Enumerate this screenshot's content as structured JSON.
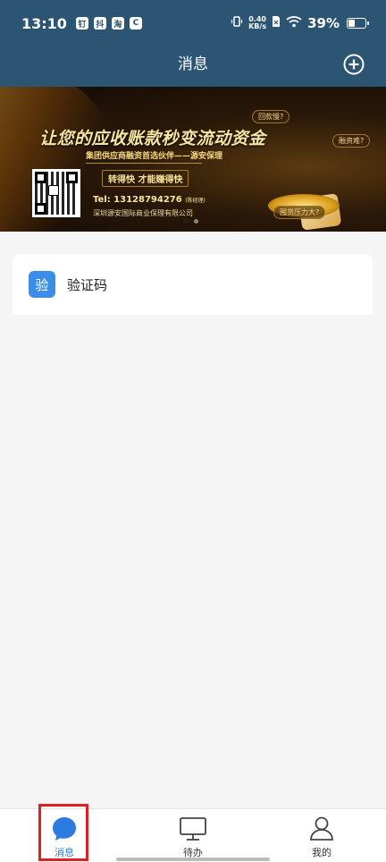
{
  "status_bar": {
    "time": "13:10",
    "app_icons": [
      "钉",
      "抖",
      "淘",
      "C"
    ],
    "net_speed_value": "0.40",
    "net_speed_unit": "KB/s",
    "battery_text": "39%",
    "battery_level": 0.39
  },
  "header": {
    "title": "消息",
    "add_icon": "plus-circle-icon"
  },
  "banner": {
    "headline": "让您的应收账款秒变流动资金",
    "subline": "集团供应商融资首选伙伴——源安保理",
    "slogan": "转得快  才能赚得快",
    "tel_label": "Tel: 13128794276",
    "tel_note": "(陈经理)",
    "company": "深圳源安国际商业保理有限公司",
    "bubbles": [
      "回款慢?",
      "融资难?",
      "囤货压力大?"
    ],
    "page_count": 2,
    "active_page": 1
  },
  "messages": [
    {
      "icon_text": "验",
      "label": "验证码",
      "icon_color": "#3a8eea"
    }
  ],
  "bottom_nav": {
    "items": [
      {
        "label": "消息",
        "icon": "chat-bubble-icon",
        "active": true
      },
      {
        "label": "待办",
        "icon": "monitor-icon",
        "active": false
      },
      {
        "label": "我的",
        "icon": "user-icon",
        "active": false
      }
    ],
    "active_color": "#2d7be0",
    "highlight_color": "#e02020"
  },
  "colors": {
    "header_bg": "#2b5573",
    "page_bg": "#f5f5f5"
  }
}
